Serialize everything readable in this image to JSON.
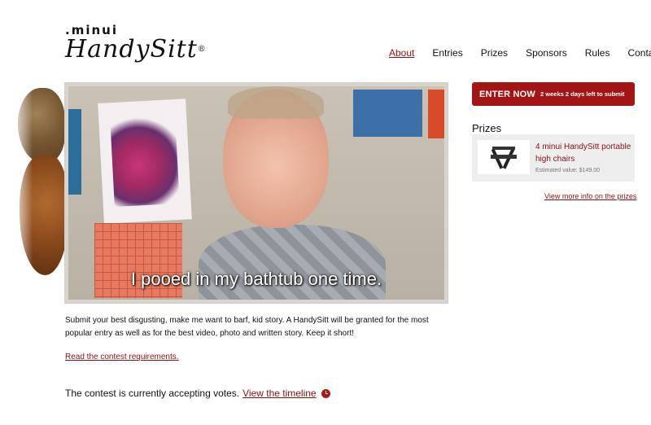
{
  "logo": {
    "small": ".minui",
    "big": "HandySitt",
    "mark": "®"
  },
  "nav": {
    "items": [
      {
        "label": "About",
        "active": true
      },
      {
        "label": "Entries",
        "active": false
      },
      {
        "label": "Prizes",
        "active": false
      },
      {
        "label": "Sponsors",
        "active": false
      },
      {
        "label": "Rules",
        "active": false
      },
      {
        "label": "Contact",
        "active": false
      }
    ]
  },
  "video": {
    "subtitle": "I pooed in my bathtub one time."
  },
  "intro": {
    "text": "Submit your best disgusting, make me want to barf, kid story. A HandySitt will be granted for the most popular entry as well as for the best video, photo and written story. Keep it short!",
    "requirements_link": "Read the contest requirements."
  },
  "status": {
    "text": "The contest is currently accepting votes.",
    "link": "View the timeline",
    "icon": "clock-icon"
  },
  "sidebar": {
    "enter_label": "ENTER NOW",
    "enter_sub": "2 weeks 2 days left to submit",
    "prizes_heading": "Prizes",
    "prize": {
      "title": "4 minui HandySitt portable high chairs",
      "value": "Estimated value: $149.00"
    },
    "more_info": "View more info on the prizes"
  },
  "colors": {
    "accent": "#a31515",
    "link": "#8a1010"
  }
}
